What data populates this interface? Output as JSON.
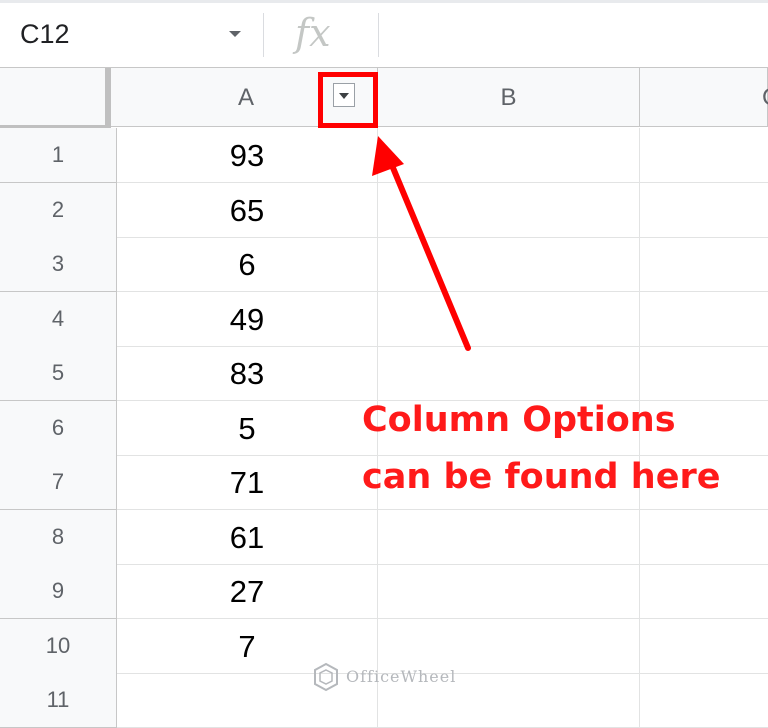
{
  "formula_bar": {
    "name_box": "C12",
    "fx_symbol": "fx",
    "formula_value": ""
  },
  "columns": [
    "A",
    "B",
    "C"
  ],
  "rows": [
    {
      "num": "1",
      "a": "93"
    },
    {
      "num": "2",
      "a": "65"
    },
    {
      "num": "3",
      "a": "6"
    },
    {
      "num": "4",
      "a": "49"
    },
    {
      "num": "5",
      "a": "83"
    },
    {
      "num": "6",
      "a": "5"
    },
    {
      "num": "7",
      "a": "71"
    },
    {
      "num": "8",
      "a": "61"
    },
    {
      "num": "9",
      "a": "27"
    },
    {
      "num": "10",
      "a": "7"
    },
    {
      "num": "11",
      "a": ""
    }
  ],
  "annotation": {
    "line1": "Column Options",
    "line2": "can be found here",
    "color": "#ff1a1a"
  },
  "watermark": {
    "text": "OfficeWheel"
  },
  "icons": {
    "name_box_dropdown": "chevron-down-icon",
    "fx": "function-icon",
    "filter": "filter-dropdown-icon",
    "arrow": "arrow-icon"
  }
}
